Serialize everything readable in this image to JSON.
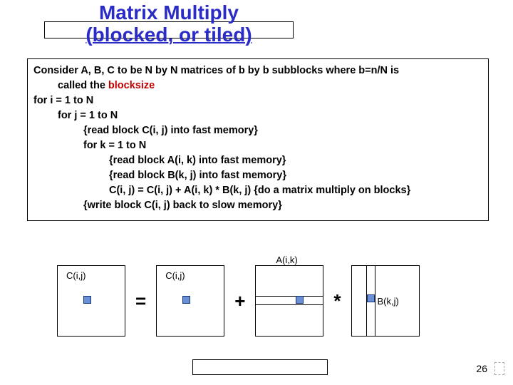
{
  "title": {
    "line1": "Matrix Multiply",
    "line2": "(blocked, or tiled)"
  },
  "code": {
    "intro_a": "Consider A, B, C to be N by N matrices of b by b subblocks where b=n/N is",
    "intro_b": "called the ",
    "blocksize": "blocksize",
    "l1": "for i = 1 to N",
    "l2": "for j = 1 to N",
    "l3": "{read block C(i, j) into fast memory}",
    "l4": "for k = 1 to N",
    "l5": "{read block A(i, k) into fast memory}",
    "l6": "{read block B(k, j) into fast memory}",
    "l7": "C(i, j) = C(i, j) + A(i, k) * B(k, j) {do a matrix multiply on blocks}",
    "l8": "{write block C(i, j) back to slow memory}"
  },
  "diagram": {
    "label_c1": "C(i,j)",
    "label_c2": "C(i,j)",
    "label_a": "A(i,k)",
    "label_b": "B(k,j)",
    "op_eq": "=",
    "op_plus": "+",
    "op_mul": "*"
  },
  "page": "26"
}
